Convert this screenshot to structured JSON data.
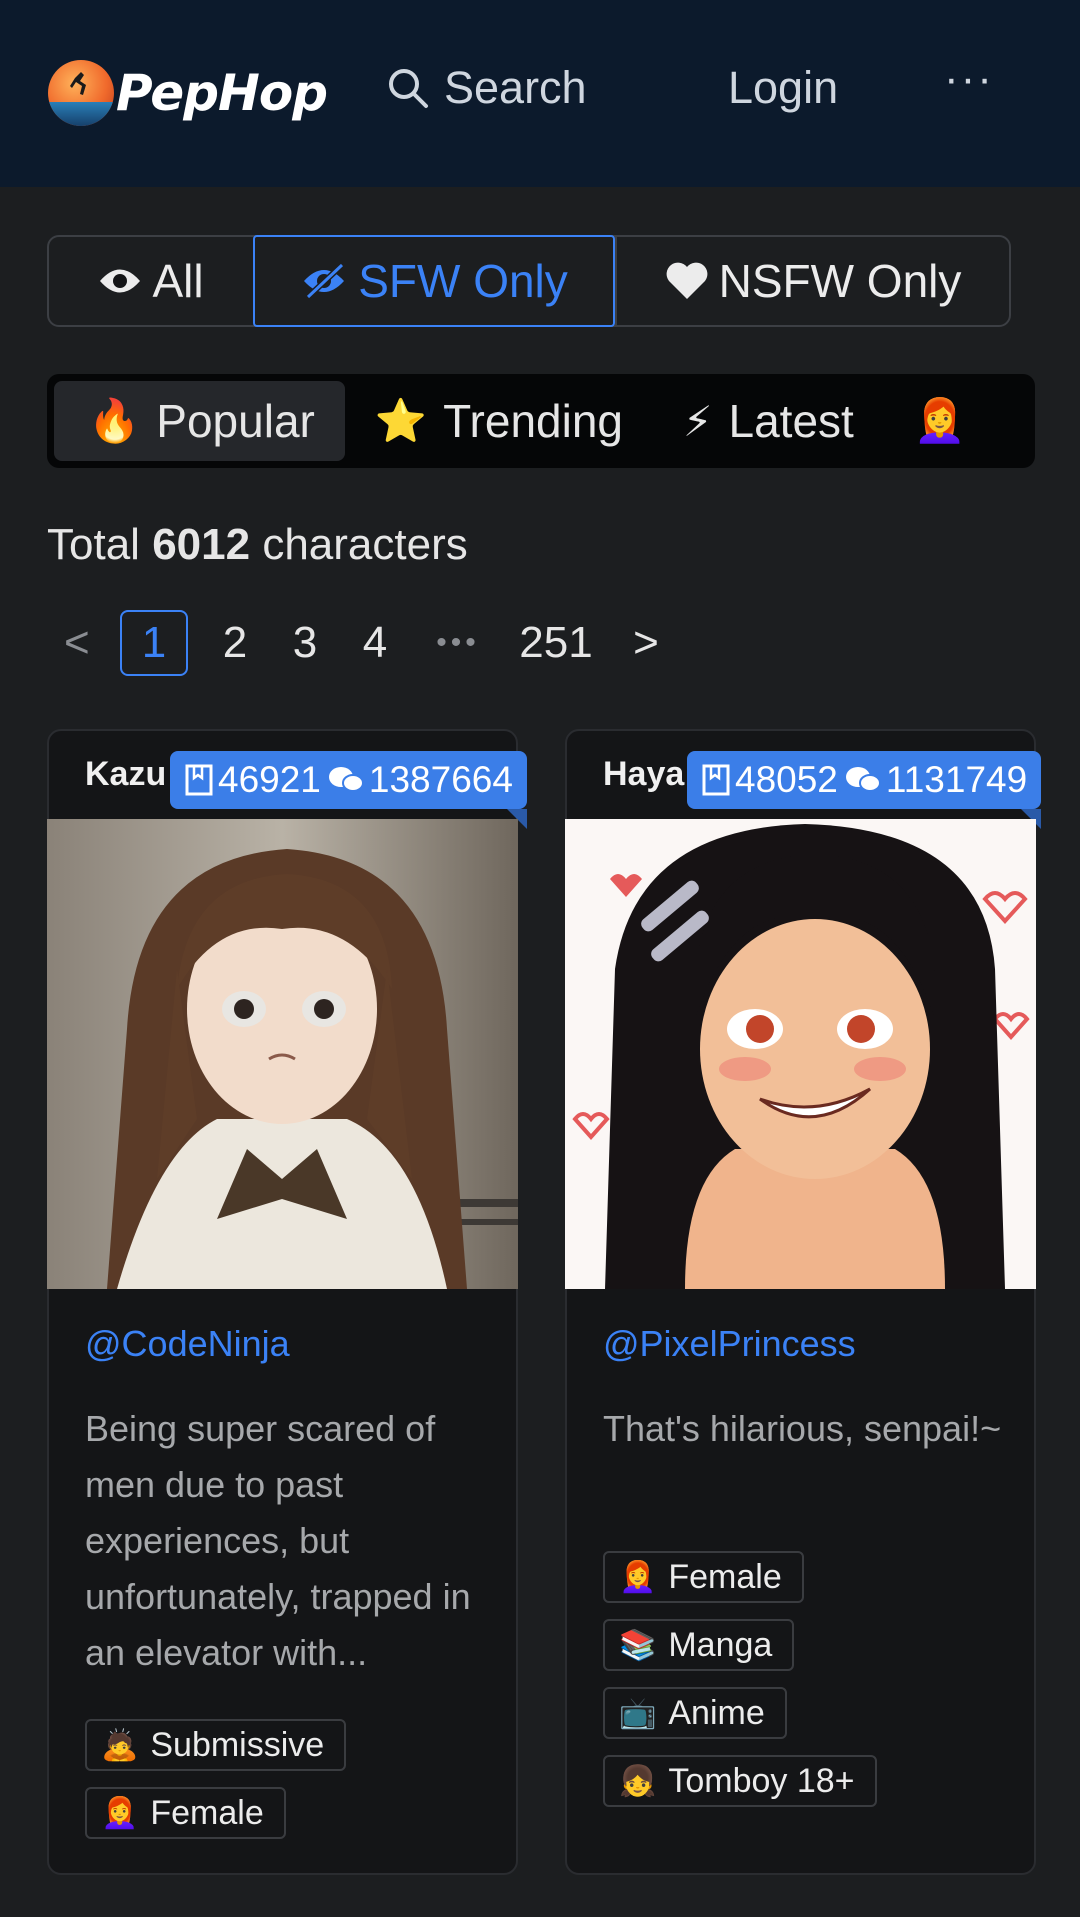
{
  "header": {
    "brand": "PepHop",
    "search_label": "Search",
    "login_label": "Login",
    "more_label": "···"
  },
  "content_filter": {
    "all_label": "All",
    "sfw_label": "SFW Only",
    "nsfw_label": "NSFW Only",
    "selected": "SFW Only",
    "accent_color": "#3b82f6"
  },
  "sort_tabs": [
    {
      "icon": "🔥",
      "label": "Popular",
      "active": true
    },
    {
      "icon": "⭐",
      "label": "Trending",
      "active": false
    },
    {
      "icon": "⚡",
      "label": "Latest",
      "active": false
    },
    {
      "icon": "👩‍🦰",
      "label": "",
      "active": false
    }
  ],
  "total": {
    "prefix": "Total",
    "count": "6012",
    "suffix": "characters"
  },
  "pagination": {
    "prev": "<",
    "pages": [
      "1",
      "2",
      "3",
      "4"
    ],
    "current": "1",
    "ellipsis": "•••",
    "last": "251",
    "next": ">"
  },
  "cards": [
    {
      "name": "Kazu",
      "stats_views": "46921",
      "stats_chats": "1387664",
      "author": "@CodeNinja",
      "description": "Being super scared of men due to past experiences, but unfortunately, trapped in an elevator with...",
      "tags": [
        {
          "icon": "🙇",
          "label": "Submissive"
        },
        {
          "icon": "👩‍🦰",
          "label": "Female"
        }
      ]
    },
    {
      "name": "Haya",
      "stats_views": "48052",
      "stats_chats": "1131749",
      "author": "@PixelPrincess",
      "description": "That's hilarious, senpai!~",
      "tags": [
        {
          "icon": "👩‍🦰",
          "label": "Female"
        },
        {
          "icon": "📚",
          "label": "Manga"
        },
        {
          "icon": "📺",
          "label": "Anime"
        },
        {
          "icon": "👧",
          "label": "Tomboy 18+"
        }
      ]
    }
  ]
}
